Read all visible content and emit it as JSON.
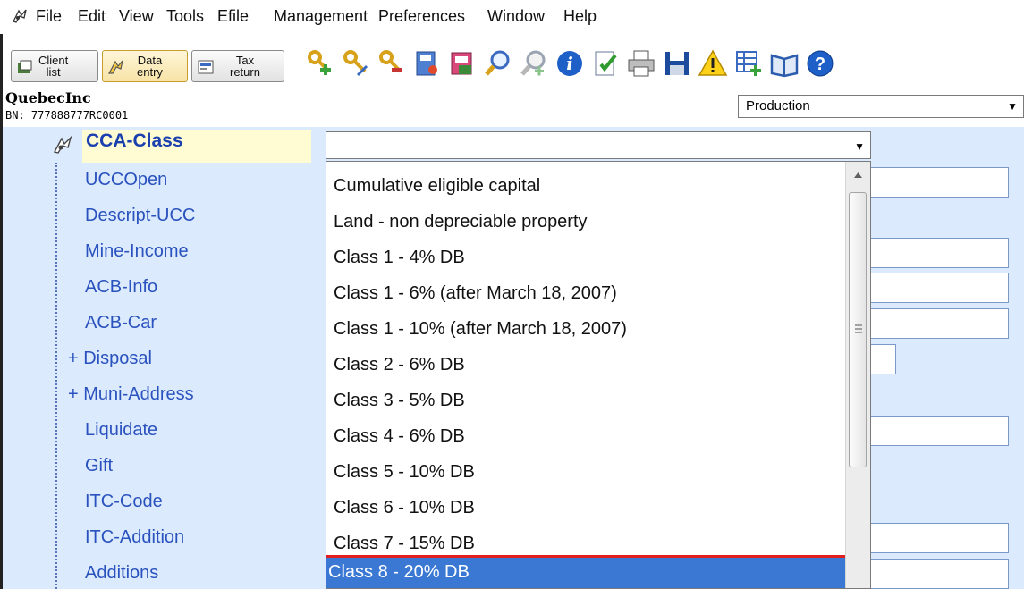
{
  "menu": {
    "items": [
      "File",
      "Edit",
      "View",
      "Tools",
      "Efile",
      "Management",
      "Preferences",
      "Window",
      "Help"
    ]
  },
  "toolbar": {
    "tabs": [
      {
        "line1": "Client",
        "line2": "list"
      },
      {
        "line1": "Data",
        "line2": "entry"
      },
      {
        "line1": "Tax",
        "line2": "return"
      }
    ],
    "icons": [
      "add-key-icon",
      "edit-key-icon",
      "remove-key-icon",
      "book-icon",
      "calendar-book-icon",
      "search-icon",
      "search-add-icon",
      "info-icon",
      "document-check-icon",
      "print-icon",
      "save-icon",
      "warning-icon",
      "grid-add-icon",
      "book-open-icon",
      "help-icon"
    ]
  },
  "client": {
    "name": "QuebecInc",
    "bn": "BN: 777888777RC0001"
  },
  "mode_select": {
    "value": "Production"
  },
  "tree": {
    "selected_field": "CCA-Class",
    "items": [
      {
        "label": "UCCOpen",
        "prefix": ""
      },
      {
        "label": "Descript-UCC",
        "prefix": ""
      },
      {
        "label": "Mine-Income",
        "prefix": ""
      },
      {
        "label": "ACB-Info",
        "prefix": ""
      },
      {
        "label": "ACB-Car",
        "prefix": ""
      },
      {
        "label": "+ Disposal",
        "prefix": "+"
      },
      {
        "label": "+ Muni-Address",
        "prefix": "+"
      },
      {
        "label": "Liquidate",
        "prefix": ""
      },
      {
        "label": "Gift",
        "prefix": ""
      },
      {
        "label": "ITC-Code",
        "prefix": ""
      },
      {
        "label": "ITC-Addition",
        "prefix": ""
      },
      {
        "label": "Additions",
        "prefix": ""
      }
    ]
  },
  "cca_dropdown": {
    "current_value": "",
    "options": [
      "Cumulative eligible capital",
      "Land - non depreciable property",
      "Class 1 - 4% DB",
      "Class 1 - 6% (after March 18, 2007)",
      "Class 1 - 10% (after March 18, 2007)",
      "Class 2 - 6% DB",
      "Class 3 - 5% DB",
      "Class 4 - 6% DB",
      "Class 5 - 10% DB",
      "Class 6 - 10% DB",
      "Class 7 - 15% DB",
      "Class 8 - 20% DB"
    ],
    "highlighted_index": 11
  },
  "colors": {
    "tree_background": "#dbeafd",
    "tree_text": "#2a52be",
    "selection": "#3a78d4",
    "highlight_border": "#e11f1f"
  }
}
